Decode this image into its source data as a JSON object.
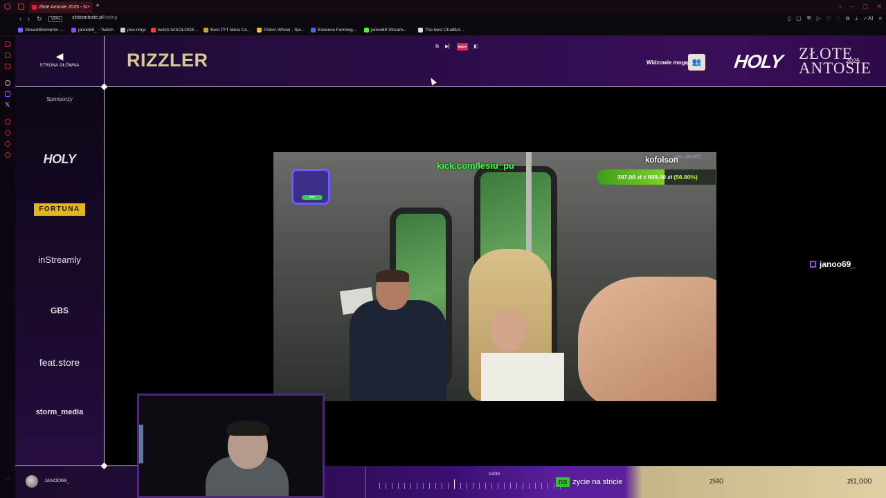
{
  "browser": {
    "tab_title": "Złote Antosie 2025 - N",
    "url_host": "zloteantosie.pl",
    "url_path": "/voting",
    "vpn_label": "VPN",
    "bookmarks": [
      {
        "label": "StreamElements -...",
        "color": "#7a5cff"
      },
      {
        "label": "janoo69_ - Twitch",
        "color": "#9146ff"
      },
      {
        "label": "poe.ninja",
        "color": "#cccccc"
      },
      {
        "label": "twitch.tv/SOLOGE...",
        "color": "#e0463c"
      },
      {
        "label": "Best TFT Meta Co...",
        "color": "#c9a04a"
      },
      {
        "label": "Picker Wheel - Spi...",
        "color": "#f0c030"
      },
      {
        "label": "Essence Farming...",
        "color": "#4070e0"
      },
      {
        "label": "janoo69 Stream...",
        "color": "#53fc18"
      },
      {
        "label": "The best ChatBot...",
        "color": "#dddddd"
      }
    ]
  },
  "header": {
    "back_label": "STRONA GŁÓWNA",
    "category_title": "RIZZLER",
    "live_badge": "REDX",
    "viewers_label": "Widzowie mogą",
    "brand_holy": "HOLY",
    "brand_zlote": "ZŁOTE",
    "brand_antosie": "ANTOSIE",
    "brand_year": "2025"
  },
  "sidebar": {
    "heading": "Sponsorzy",
    "sponsors": [
      "HOLY",
      "FORTUNA",
      "inStreamly",
      "GBS",
      "feat.store",
      "storm_media"
    ]
  },
  "video": {
    "kick_url": "kick.com/lesiu_pu",
    "streamer": "kofolson",
    "rtt": "kb/s • 156 RTT",
    "donation_text": "397,00 zł z 699,00 zł",
    "donation_pct": "(56.80%)",
    "donation_fraction": 0.568
  },
  "channel_tag": "janoo69_",
  "bottom": {
    "username": "JANOO69_",
    "progress": "13/30",
    "bet_highlight": "na",
    "bet_text": "zycie na stricie",
    "goal_current": "zł40",
    "goal_max": "zł1,000"
  }
}
